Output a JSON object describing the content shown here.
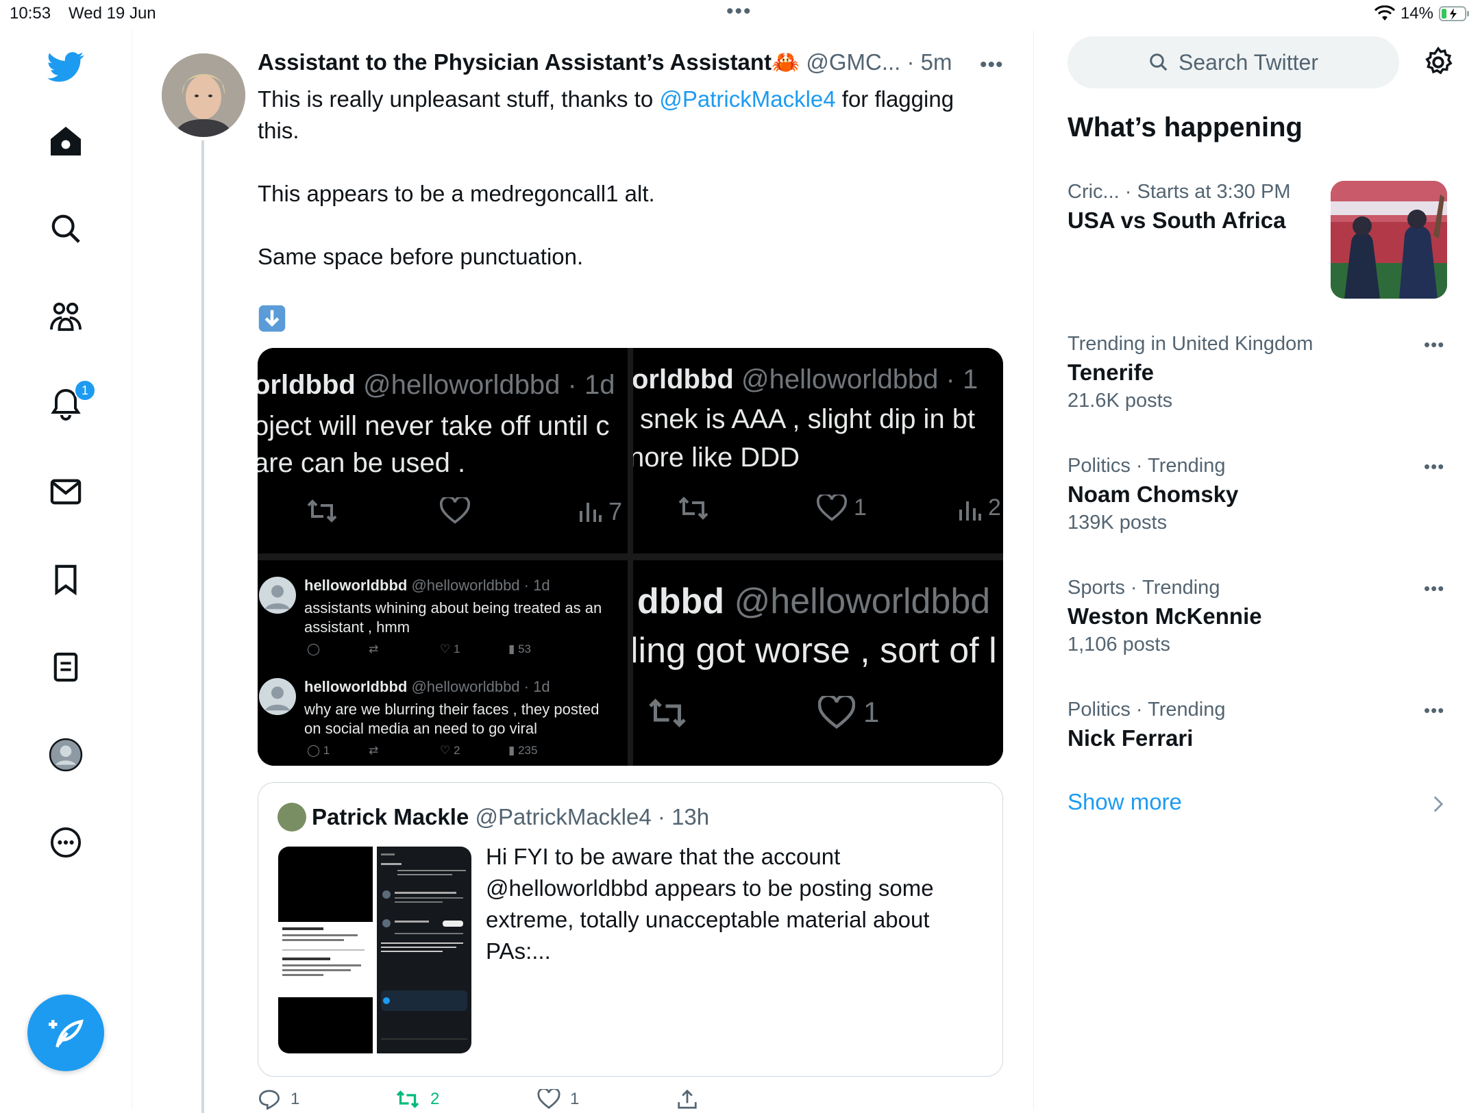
{
  "status_bar": {
    "time": "10:53",
    "date": "Wed 19 Jun",
    "battery": "14%"
  },
  "nav": {
    "notifications_badge": "1"
  },
  "tweet": {
    "display_name": "Assistant to the Physician Assistant’s Assistant🦀",
    "handle": "@GMC...",
    "separator": "·",
    "time": "5m",
    "text_line1_pre": "This is really unpleasant stuff, thanks to ",
    "text_line1_link": "@PatrickMackle4",
    "text_line1_post": " for flagging this.",
    "text_para2": "This appears to be a medregoncall1 alt.",
    "text_para3": "Same space before punctuation.",
    "text_emoji": "⬇️",
    "media": {
      "cell1": {
        "line1_name": "orldbbd",
        "line1_meta": "@helloworldbbd · 1d",
        "line2": "oject will never take off until c",
        "line3": "are can be used .",
        "views": "7"
      },
      "cell2": {
        "line1_name": "orldbbd",
        "line1_meta": "@helloworldbbd · 1",
        "line2": "snek is AAA , slight dip in bt",
        "line3": "nore like DDD",
        "likes": "1",
        "views": "2"
      },
      "cell3": {
        "post1_name": "helloworldbbd",
        "post1_meta": "@helloworldbbd · 1d",
        "post1_text": "assistants whining about being treated as an assistant , hmm",
        "post1_likes": "1",
        "post1_views": "53",
        "post2_name": "helloworldbbd",
        "post2_meta": "@helloworldbbd · 1d",
        "post2_text": "why are we blurring their faces , they posted on social media an need to go viral",
        "post2_replies": "1",
        "post2_likes": "2",
        "post2_views": "235"
      },
      "cell4": {
        "line1_name": "dbbd",
        "line1_meta": "@helloworldbbd",
        "line2": "ling got worse , sort of l",
        "likes": "1"
      }
    },
    "quote": {
      "display_name": "Patrick Mackle",
      "handle": "@PatrickMackle4",
      "separator": "·",
      "time": "13h",
      "text": "Hi FYI  to be aware that the account @helloworldbbd appears to be posting some extreme, totally unacceptable material about PAs:..."
    },
    "actions": {
      "replies": "1",
      "retweets": "2",
      "likes": "1"
    }
  },
  "right": {
    "search_placeholder": "Search Twitter",
    "whats_happening": "What’s happening",
    "trends": [
      {
        "category": "Cric...",
        "extra": " · Starts at 3:30 PM",
        "name": "USA vs South Africa",
        "count": ""
      },
      {
        "category": "Trending in United Kingdom",
        "extra": "",
        "name": "Tenerife",
        "count": "21.6K posts"
      },
      {
        "category": "Politics · Trending",
        "extra": "",
        "name": "Noam Chomsky",
        "count": "139K posts"
      },
      {
        "category": "Sports · Trending",
        "extra": "",
        "name": "Weston McKennie",
        "count": "1,106 posts"
      },
      {
        "category": "Politics · Trending",
        "extra": "",
        "name": "Nick Ferrari",
        "count": ""
      }
    ],
    "show_more": "Show more"
  },
  "colors": {
    "accent": "#1d9bf0",
    "text": "#0f1419",
    "muted": "#536471",
    "retweet_green": "#00ba7c"
  }
}
